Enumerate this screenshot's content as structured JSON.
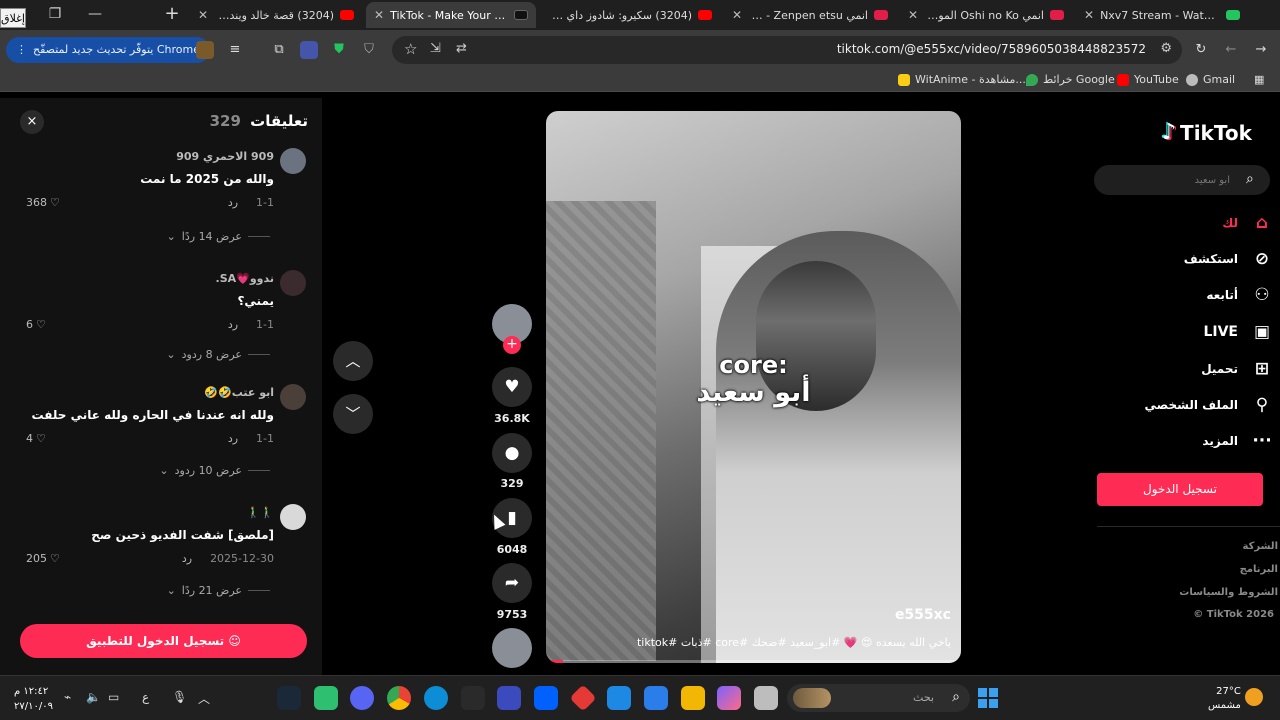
{
  "browser": {
    "close_label": "إغلاق",
    "tabs": [
      {
        "title": "Nxv7 Stream - Watch Live",
        "color": "#22c55e",
        "active": false
      },
      {
        "title": "انمي Oshi no Ko الموسم 3",
        "color": "#e11d48",
        "active": false
      },
      {
        "title": "انمي Kaijuu - Zenpen etsu",
        "color": "#e11d48",
        "active": false
      },
      {
        "title": "(3204) سكيرو: شادوز داي توايس",
        "color": "#ff0000",
        "active": false
      },
      {
        "title": "TikTok - Make Your Day",
        "color": "#111111",
        "active": true
      },
      {
        "title": "(3204) قصة خالد ويندر !!! الا",
        "color": "#ff0000",
        "active": false
      }
    ],
    "update_label": "يتوفّر تحديث جديد لمتصفّح Chrome",
    "url": "tiktok.com/@e555xc/video/7589605038448823572",
    "bookmarks": [
      {
        "label": "Gmail",
        "color": "#ffffff"
      },
      {
        "label": "YouTube",
        "color": "#ff0000"
      },
      {
        "label": "خرائط Google",
        "color": "#34a853"
      },
      {
        "label": "WitAnime - مشاهدة...",
        "color": "#facc15"
      }
    ]
  },
  "comments": {
    "title": "تعليقات",
    "count": "329",
    "close_icon": "×",
    "items": [
      {
        "user": "909 الاحمري 909",
        "text": "والله من 2025 ما نمت",
        "date": "1-1",
        "reply": "رد",
        "likes": "368",
        "more": "عرض 14 ردًا"
      },
      {
        "user": "ندوو💗SA.",
        "text": "يمني؟",
        "date": "1-1",
        "reply": "رد",
        "likes": "6",
        "more": "عرض 8 ردود"
      },
      {
        "user": "ابو عتب🤣🤣",
        "text": "ولله انه عندنا في الحاره ولله عاني حلفت",
        "date": "1-1",
        "reply": "رد",
        "likes": "4",
        "more": "عرض 10 ردود"
      },
      {
        "user": "🚶‍♂️🚶‍♂️",
        "text": "[ملصق] شفت الفديو ذحين صح",
        "date": "2025-12-30",
        "reply": "رد",
        "likes": "205",
        "more": "عرض 21 ردًا"
      }
    ],
    "login_app": "تسجيل الدخول للتطبيق"
  },
  "actions": {
    "likes": "36.8K",
    "comments": "329",
    "saves": "6048",
    "shares": "9753"
  },
  "video": {
    "caption_line1": "core:",
    "caption_line2": "أبو سعيد",
    "author": "e555xc",
    "description": "ياخي الله يسعده 😍 💗 #ابو_سعيد #ضحك #core #ذبات #tiktok",
    "progress": 0.04
  },
  "sidebar": {
    "logo": "TikTok",
    "search_placeholder": "ابو سعيد",
    "items": [
      {
        "label": "لك",
        "icon": "home-icon",
        "active": true
      },
      {
        "label": "استكشف",
        "icon": "compass-icon",
        "active": false
      },
      {
        "label": "أتابعه",
        "icon": "user-plus-icon",
        "active": false
      },
      {
        "label": "LIVE",
        "icon": "live-icon",
        "active": false
      },
      {
        "label": "تحميل",
        "icon": "upload-icon",
        "active": false
      },
      {
        "label": "الملف الشخصي",
        "icon": "profile-icon",
        "active": false
      },
      {
        "label": "المزيد",
        "icon": "more-icon",
        "active": false
      }
    ],
    "login_label": "تسجيل الدخول",
    "footer": [
      "الشركة",
      "البرنامج",
      "الشروط والسياسات",
      "© TikTok 2026"
    ]
  },
  "taskbar": {
    "time": "١٢:٤٢ م",
    "date": "٢٧/١٠/٠٩",
    "search_label": "بحث",
    "lang": "ع",
    "weather_temp": "27°C",
    "weather_desc": "مشمس"
  }
}
